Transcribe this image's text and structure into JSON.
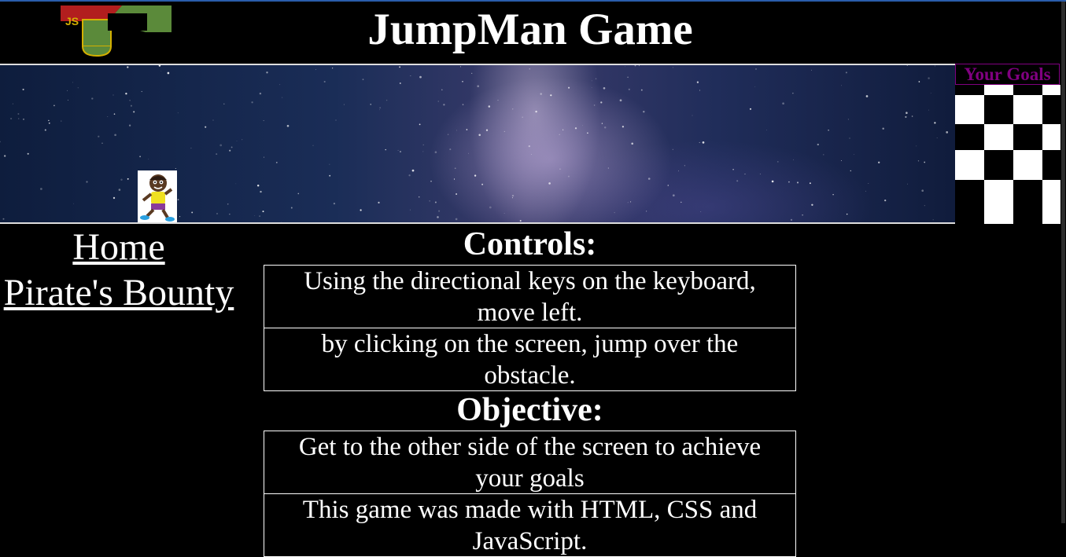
{
  "header": {
    "title": "JumpMan Game"
  },
  "logo": {
    "icon": "js-logo-icon",
    "text": "JS"
  },
  "goals": {
    "label": "Your Goals",
    "label_color": "#800080"
  },
  "nav": {
    "links": [
      {
        "label": "Home"
      },
      {
        "label": "Pirate's Bounty"
      }
    ]
  },
  "controls": {
    "title": "Controls:",
    "items": [
      "Using the directional keys on the keyboard, move left.",
      "by clicking on the screen, jump over the obstacle."
    ]
  },
  "objective": {
    "title": "Objective:",
    "items": [
      "Get to the other side of the screen to achieve your goals",
      "This game was made with HTML, CSS and JavaScript."
    ]
  },
  "colors": {
    "background": "#000000",
    "text": "#ffffff",
    "accent": "#800080",
    "top_border": "#2a5dab"
  }
}
